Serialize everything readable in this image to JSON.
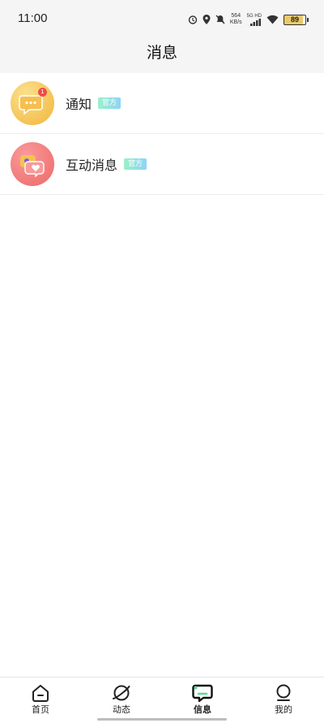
{
  "status": {
    "time": "11:00",
    "net_speed_value": "564",
    "net_speed_unit": "KB/s",
    "network": "5G HD",
    "battery": "89"
  },
  "header": {
    "title": "消息"
  },
  "messages": [
    {
      "label": "通知",
      "badge": "官方",
      "unread": "1"
    },
    {
      "label": "互动消息",
      "badge": "官方"
    }
  ],
  "tabbar": [
    {
      "label": "首页",
      "icon": "home-icon"
    },
    {
      "label": "动态",
      "icon": "planet-icon"
    },
    {
      "label": "信息",
      "icon": "chat-icon",
      "active": true
    },
    {
      "label": "我的",
      "icon": "profile-icon"
    }
  ],
  "colors": {
    "accent": "#56e08a",
    "notify_avatar": "#f2b53a",
    "interact_avatar": "#ee6868",
    "unread_dot": "#ef4a4a"
  }
}
